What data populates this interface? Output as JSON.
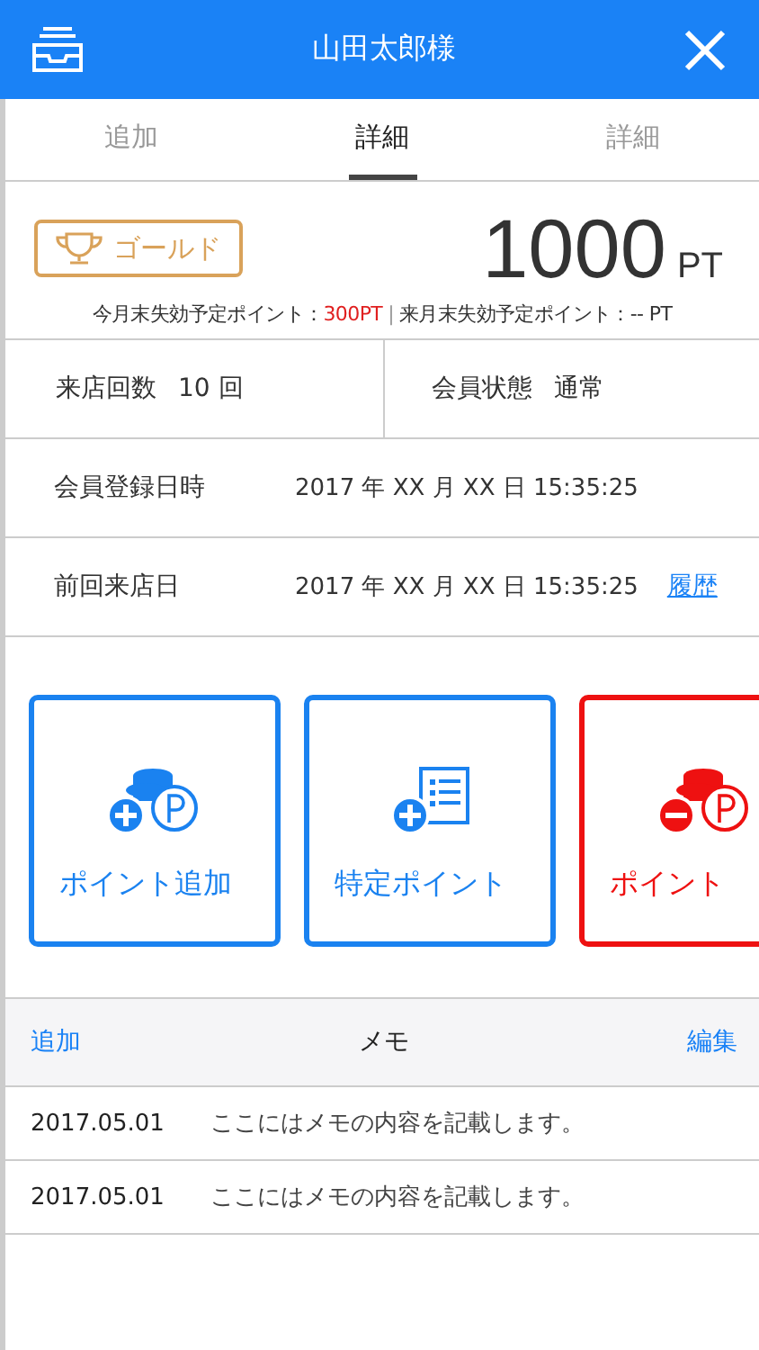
{
  "header": {
    "title": "山田太郎様"
  },
  "tabs": [
    {
      "label": "追加",
      "selected": false
    },
    {
      "label": "詳細",
      "selected": true
    },
    {
      "label": "詳細",
      "selected": false
    }
  ],
  "points": {
    "rank": "ゴールド",
    "value": "1000",
    "unit": "PT",
    "expiry_this_month_label": "今月末失効予定ポイント：",
    "expiry_this_month_value": "300PT",
    "separator": "|",
    "expiry_next_month": "来月末失効予定ポイント：-- PT"
  },
  "stats": [
    {
      "label": "来店回数",
      "value": "10 回"
    },
    {
      "label": "会員状態",
      "value": "通常"
    }
  ],
  "info_rows": [
    {
      "label": "会員登録日時",
      "value": "2017 年 XX 月 XX 日 15:35:25"
    },
    {
      "label": "前回来店日",
      "value": "2017 年 XX 月 XX 日 15:35:25",
      "link": "履歴"
    }
  ],
  "actions": [
    {
      "label": "ポイント追加",
      "kind": "coins-plus",
      "color": "#1a82f0"
    },
    {
      "label": "特定ポイント",
      "kind": "list-plus",
      "color": "#1a82f0"
    },
    {
      "label": "ポイント",
      "kind": "coins-minus",
      "color": "#ee1111"
    }
  ],
  "memo": {
    "add": "追加",
    "title": "メモ",
    "edit": "編集",
    "rows": [
      {
        "date": "2017.05.01",
        "text": "ここにはメモの内容を記載します。"
      },
      {
        "date": "2017.05.01",
        "text": "ここにはメモの内容を記載します。"
      }
    ]
  }
}
